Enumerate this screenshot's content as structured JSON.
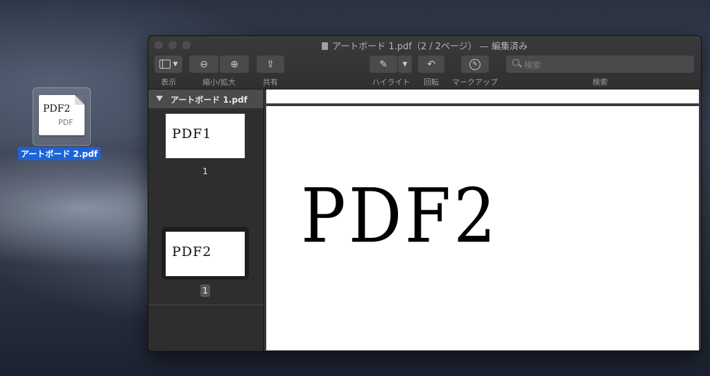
{
  "desktop": {
    "file_icon": {
      "thumb_text": "PDF2",
      "type_text": "PDF",
      "label": "アートボード 2.pdf"
    }
  },
  "window": {
    "title": "アートボード 1.pdf（2 / 2ページ） — 編集済み",
    "toolbar": {
      "view_label": "表示",
      "zoom_label": "縮小/拡大",
      "share_label": "共有",
      "highlight_label": "ハイライト",
      "rotate_label": "回転",
      "markup_label": "マークアップ",
      "search_placeholder": "検索",
      "search_label": "検索"
    },
    "sidebar": {
      "document_name": "アートボード 1.pdf",
      "pages": [
        {
          "thumb_text": "PDF1",
          "page_label": "1"
        },
        {
          "thumb_text": "PDF2",
          "page_label": "1"
        }
      ]
    },
    "content": {
      "page_text": "PDF2"
    }
  }
}
